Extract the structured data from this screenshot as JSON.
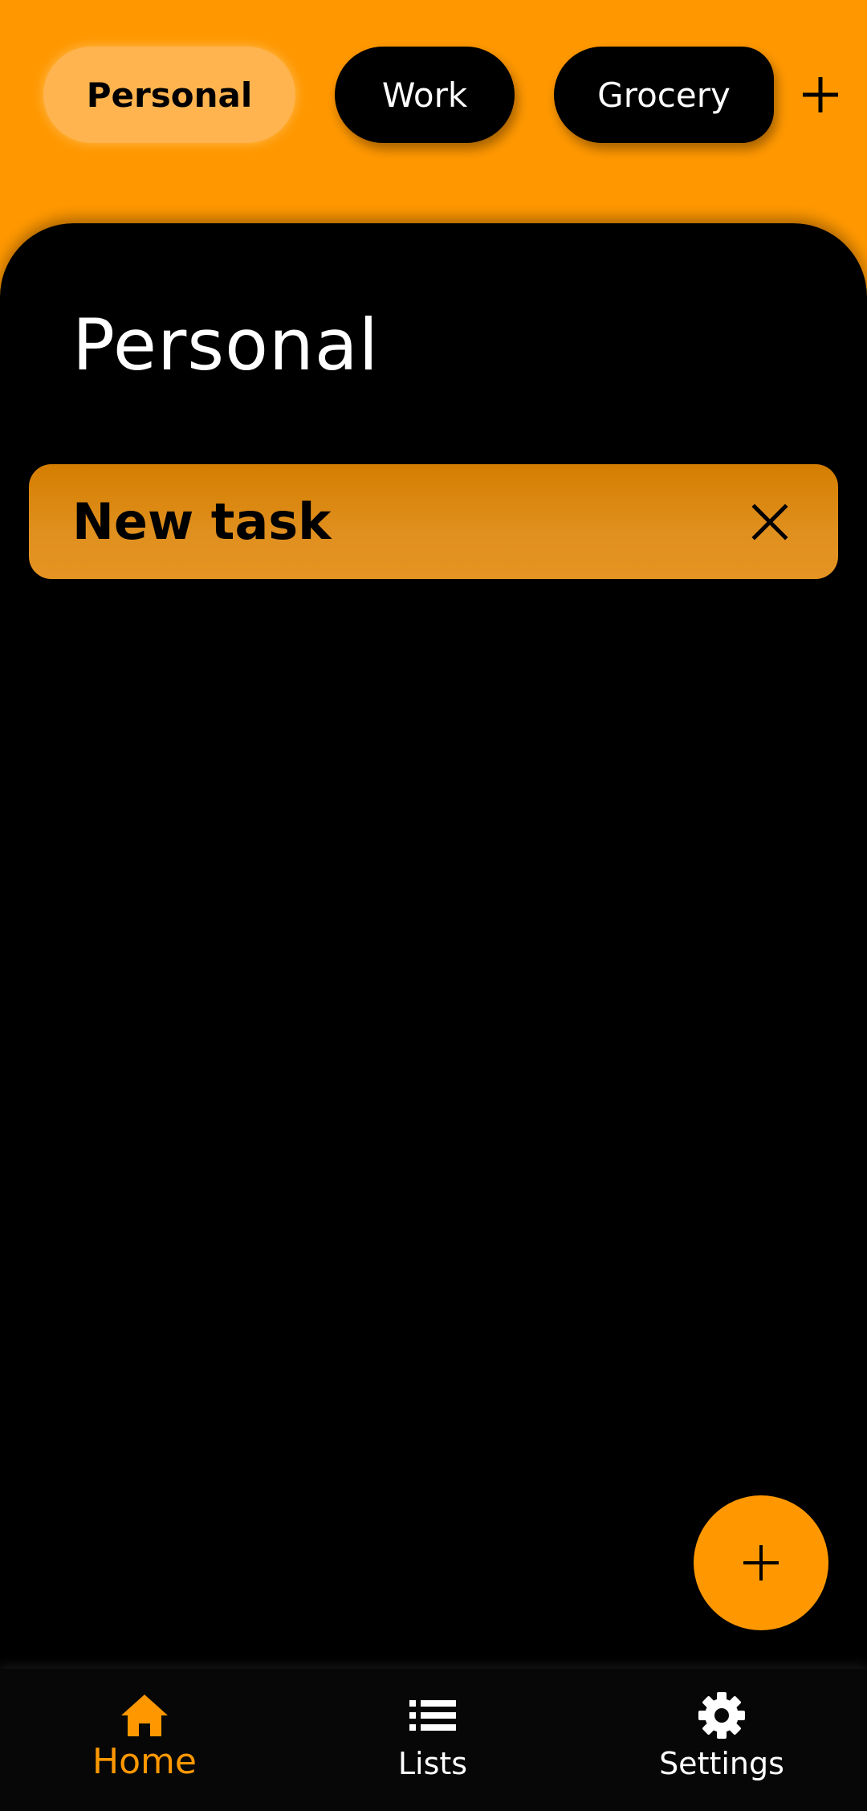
{
  "colors": {
    "accent": "#FF9800",
    "panel": "#000000",
    "task_bg": "#E08F1E",
    "active_chip": "#FFB44F"
  },
  "chips": {
    "items": [
      {
        "label": "Personal",
        "active": true
      },
      {
        "label": "Work",
        "active": false
      },
      {
        "label": "Grocery",
        "active": false
      }
    ],
    "add_icon": "plus-icon"
  },
  "main": {
    "title": "Personal",
    "tasks": [
      {
        "text": "New task",
        "action_icon": "close-icon"
      }
    ],
    "fab_icon": "plus-icon"
  },
  "bottom_nav": {
    "items": [
      {
        "label": "Home",
        "icon": "home-icon",
        "active": true
      },
      {
        "label": "Lists",
        "icon": "list-icon",
        "active": false
      },
      {
        "label": "Settings",
        "icon": "gear-icon",
        "active": false
      }
    ]
  }
}
